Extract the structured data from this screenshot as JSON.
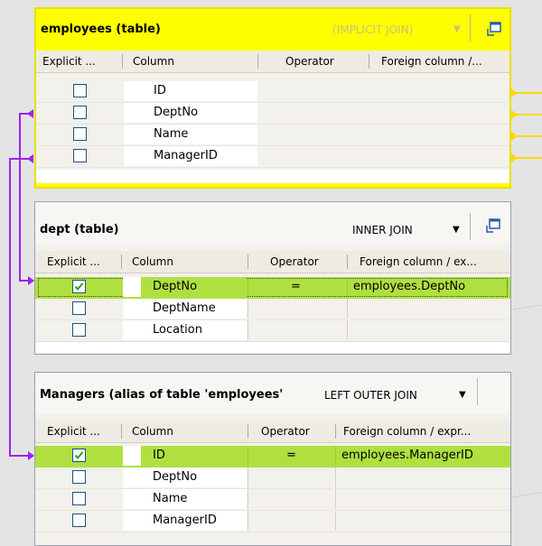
{
  "colors": {
    "selected_header": "#ffff00",
    "selected_row": "#b0e040",
    "link_line": "#a020f0",
    "outgoing_link": "#ffd800",
    "panel_bg": "#f2f1eb"
  },
  "panels": [
    {
      "title": "employees  (table)",
      "join_type": "(IMPLICIT JOIN)",
      "join_enabled": false,
      "header_icon": "restore-window-icon",
      "columns": [
        "Explicit ...",
        "Column",
        "Operator",
        "Foreign column /..."
      ],
      "rows": [
        {
          "checked": false,
          "column": "ID",
          "operator": "",
          "foreign": ""
        },
        {
          "checked": false,
          "column": "DeptNo",
          "operator": "",
          "foreign": ""
        },
        {
          "checked": false,
          "column": "Name",
          "operator": "",
          "foreign": ""
        },
        {
          "checked": false,
          "column": "ManagerID",
          "operator": "",
          "foreign": ""
        }
      ]
    },
    {
      "title": "dept  (table)",
      "join_type": "INNER JOIN",
      "join_enabled": true,
      "header_icon": "restore-window-icon",
      "columns": [
        "Explicit ...",
        "Column",
        "Operator",
        "Foreign column / ex..."
      ],
      "rows": [
        {
          "checked": true,
          "column": "DeptNo",
          "operator": "=",
          "foreign": "employees.DeptNo"
        },
        {
          "checked": false,
          "column": "DeptName",
          "operator": "",
          "foreign": ""
        },
        {
          "checked": false,
          "column": "Location",
          "operator": "",
          "foreign": ""
        }
      ]
    },
    {
      "title": "Managers  (alias of table 'employees'",
      "join_type": "LEFT OUTER JOIN",
      "join_enabled": true,
      "columns": [
        "Explicit ...",
        "Column",
        "Operator",
        "Foreign column / expr..."
      ],
      "rows": [
        {
          "checked": true,
          "column": "ID",
          "operator": "=",
          "foreign": "employees.ManagerID"
        },
        {
          "checked": false,
          "column": "DeptNo",
          "operator": "",
          "foreign": ""
        },
        {
          "checked": false,
          "column": "Name",
          "operator": "",
          "foreign": ""
        },
        {
          "checked": false,
          "column": "ManagerID",
          "operator": "",
          "foreign": ""
        }
      ]
    }
  ]
}
